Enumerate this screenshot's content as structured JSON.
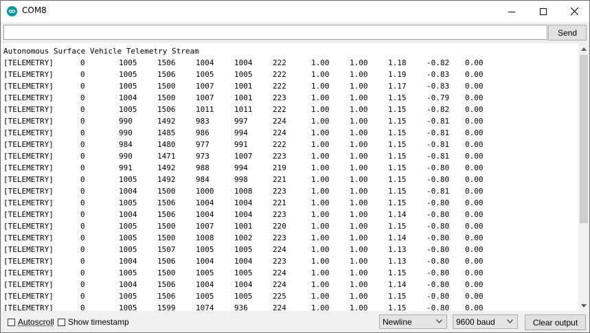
{
  "window": {
    "title": "COM8"
  },
  "toolbar": {
    "input_value": "",
    "send_label": "Send"
  },
  "output": {
    "header": "Autonomous Surface Vehicle Telemetry Stream",
    "rows": [
      [
        "[TELEMETRY]",
        "0",
        "1005",
        "1506",
        "1004",
        "1004",
        "222",
        "1.00",
        "1.00",
        "1.18",
        "-0.82",
        "0.00"
      ],
      [
        "[TELEMETRY]",
        "0",
        "1005",
        "1506",
        "1005",
        "1005",
        "222",
        "1.00",
        "1.00",
        "1.19",
        "-0.83",
        "0.00"
      ],
      [
        "[TELEMETRY]",
        "0",
        "1005",
        "1500",
        "1007",
        "1001",
        "222",
        "1.00",
        "1.00",
        "1.17",
        "-0.83",
        "0.00"
      ],
      [
        "[TELEMETRY]",
        "0",
        "1004",
        "1500",
        "1007",
        "1001",
        "223",
        "1.00",
        "1.00",
        "1.15",
        "-0.79",
        "0.00"
      ],
      [
        "[TELEMETRY]",
        "0",
        "1005",
        "1506",
        "1011",
        "1011",
        "222",
        "1.00",
        "1.00",
        "1.15",
        "-0.82",
        "0.00"
      ],
      [
        "[TELEMETRY]",
        "0",
        "990",
        "1492",
        "983",
        "997",
        "224",
        "1.00",
        "1.00",
        "1.15",
        "-0.81",
        "0.00"
      ],
      [
        "[TELEMETRY]",
        "0",
        "990",
        "1485",
        "986",
        "994",
        "224",
        "1.00",
        "1.00",
        "1.15",
        "-0.81",
        "0.00"
      ],
      [
        "[TELEMETRY]",
        "0",
        "984",
        "1480",
        "977",
        "991",
        "222",
        "1.00",
        "1.00",
        "1.15",
        "-0.81",
        "0.00"
      ],
      [
        "[TELEMETRY]",
        "0",
        "990",
        "1471",
        "973",
        "1007",
        "223",
        "1.00",
        "1.00",
        "1.15",
        "-0.81",
        "0.00"
      ],
      [
        "[TELEMETRY]",
        "0",
        "991",
        "1492",
        "988",
        "994",
        "219",
        "1.00",
        "1.00",
        "1.15",
        "-0.80",
        "0.00"
      ],
      [
        "[TELEMETRY]",
        "0",
        "1005",
        "1492",
        "984",
        "998",
        "221",
        "1.00",
        "1.00",
        "1.15",
        "-0.80",
        "0.00"
      ],
      [
        "[TELEMETRY]",
        "0",
        "1004",
        "1500",
        "1000",
        "1008",
        "223",
        "1.00",
        "1.00",
        "1.15",
        "-0.81",
        "0.00"
      ],
      [
        "[TELEMETRY]",
        "0",
        "1005",
        "1506",
        "1004",
        "1004",
        "221",
        "1.00",
        "1.00",
        "1.15",
        "-0.80",
        "0.00"
      ],
      [
        "[TELEMETRY]",
        "0",
        "1004",
        "1506",
        "1004",
        "1004",
        "223",
        "1.00",
        "1.00",
        "1.14",
        "-0.80",
        "0.00"
      ],
      [
        "[TELEMETRY]",
        "0",
        "1005",
        "1500",
        "1007",
        "1001",
        "220",
        "1.00",
        "1.00",
        "1.15",
        "-0.80",
        "0.00"
      ],
      [
        "[TELEMETRY]",
        "0",
        "1005",
        "1500",
        "1008",
        "1002",
        "223",
        "1.00",
        "1.00",
        "1.14",
        "-0.80",
        "0.00"
      ],
      [
        "[TELEMETRY]",
        "0",
        "1005",
        "1507",
        "1005",
        "1005",
        "224",
        "1.00",
        "1.00",
        "1.13",
        "-0.80",
        "0.00"
      ],
      [
        "[TELEMETRY]",
        "0",
        "1004",
        "1506",
        "1004",
        "1004",
        "223",
        "1.00",
        "1.00",
        "1.13",
        "-0.80",
        "0.00"
      ],
      [
        "[TELEMETRY]",
        "0",
        "1005",
        "1500",
        "1005",
        "1005",
        "224",
        "1.00",
        "1.00",
        "1.15",
        "-0.80",
        "0.00"
      ],
      [
        "[TELEMETRY]",
        "0",
        "1004",
        "1506",
        "1004",
        "1004",
        "224",
        "1.00",
        "1.00",
        "1.14",
        "-0.80",
        "0.00"
      ],
      [
        "[TELEMETRY]",
        "0",
        "1005",
        "1506",
        "1005",
        "1005",
        "225",
        "1.00",
        "1.00",
        "1.15",
        "-0.80",
        "0.00"
      ],
      [
        "[TELEMETRY]",
        "0",
        "1005",
        "1599",
        "1074",
        "936",
        "224",
        "1.00",
        "1.00",
        "1.15",
        "-0.80",
        "0.00"
      ]
    ]
  },
  "footer": {
    "autoscroll_label": "Autoscroll",
    "autoscroll_checked": false,
    "timestamp_label": "Show timestamp",
    "timestamp_checked": false,
    "line_ending": "Newline",
    "baud": "9600 baud",
    "clear_label": "Clear output"
  },
  "icons": {
    "app": "arduino-icon",
    "minimize": "minimize-icon",
    "maximize": "maximize-icon",
    "close": "close-icon"
  },
  "colors": {
    "accent": "#00979c"
  }
}
